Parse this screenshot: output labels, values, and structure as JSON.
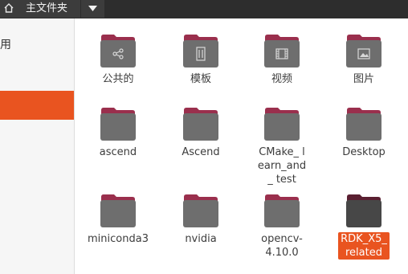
{
  "toolbar": {
    "path_label": "主文件夹"
  },
  "sidebar": {
    "partial_label": "用"
  },
  "items": [
    {
      "label": "公共的",
      "icon": "share-icon",
      "selected": false
    },
    {
      "label": "模板",
      "icon": "template-icon",
      "selected": false
    },
    {
      "label": "视频",
      "icon": "video-icon",
      "selected": false
    },
    {
      "label": "图片",
      "icon": "picture-icon",
      "selected": false
    },
    {
      "label": "ascend",
      "icon": "folder-icon",
      "selected": false
    },
    {
      "label": "Ascend",
      "icon": "folder-icon",
      "selected": false
    },
    {
      "label": "CMake_ learn_and_ test",
      "icon": "folder-icon",
      "selected": false
    },
    {
      "label": "Desktop",
      "icon": "folder-icon",
      "selected": false
    },
    {
      "label": "miniconda3",
      "icon": "folder-icon",
      "selected": false
    },
    {
      "label": "nvidia",
      "icon": "folder-icon",
      "selected": false
    },
    {
      "label": "opencv- 4.10.0",
      "icon": "folder-icon",
      "selected": false
    },
    {
      "label": "RDK_X5_ related",
      "icon": "folder-icon",
      "selected": true
    }
  ],
  "colors": {
    "accent": "#e95420",
    "folder_tab": "#9a2f4d",
    "folder_body": "#6e6e6e"
  }
}
